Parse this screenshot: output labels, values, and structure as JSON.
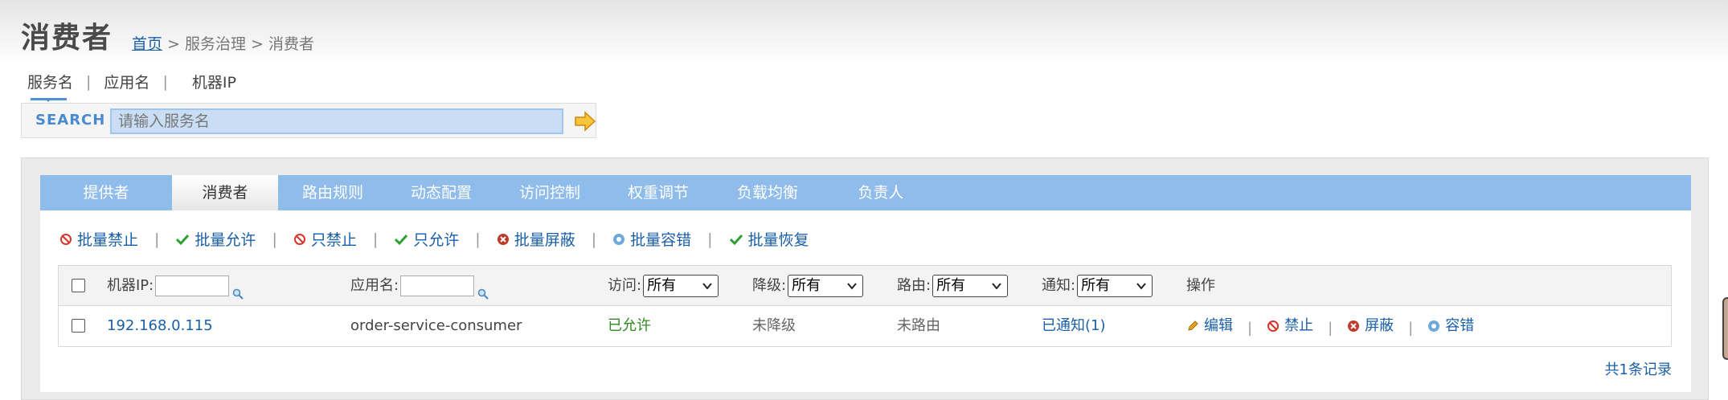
{
  "page": {
    "title": "消费者"
  },
  "breadcrumb": {
    "home": "首页",
    "rest": " > 服务治理 > 消费者"
  },
  "search_tabs": [
    "服务名",
    "应用名",
    "机器IP"
  ],
  "search": {
    "label": "SEARCH",
    "placeholder": "请输入服务名",
    "go_icon": "arrow-right-icon"
  },
  "nav": {
    "items": [
      "提供者",
      "消费者",
      "路由规则",
      "动态配置",
      "访问控制",
      "权重调节",
      "负载均衡",
      "负责人"
    ],
    "active": "消费者"
  },
  "actions": [
    {
      "label": "批量禁止",
      "icon": "forbid-icon"
    },
    {
      "label": "批量允许",
      "icon": "check-icon"
    },
    {
      "label": "只禁止",
      "icon": "forbid-icon"
    },
    {
      "label": "只允许",
      "icon": "check-icon"
    },
    {
      "label": "批量屏蔽",
      "icon": "block-icon"
    },
    {
      "label": "批量容错",
      "icon": "gear-icon"
    },
    {
      "label": "批量恢复",
      "icon": "check-icon"
    }
  ],
  "table": {
    "headers": {
      "ip": "机器IP:",
      "app": "应用名:",
      "access": "访问:",
      "degrade": "降级:",
      "route": "路由:",
      "notify": "通知:",
      "ops": "操作"
    },
    "filter_options": {
      "access": "所有",
      "degrade": "所有",
      "route": "所有",
      "notify": "所有"
    },
    "rows": [
      {
        "ip": "192.168.0.115",
        "app": "order-service-consumer",
        "access": "已允许",
        "degrade": "未降级",
        "route": "未路由",
        "notify": "已通知(1)",
        "ops": [
          "编辑",
          "禁止",
          "屏蔽",
          "容错"
        ]
      }
    ],
    "total": "共1条记录"
  },
  "colors": {
    "nav_bg": "#8fbceb",
    "link": "#1a5fa8",
    "allowed": "#2e8b1e",
    "forbid": "#d9362b"
  }
}
